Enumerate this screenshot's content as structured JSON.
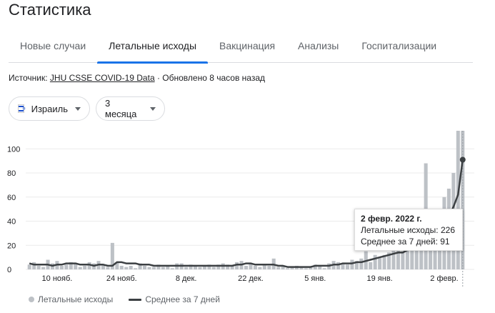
{
  "title": "Статистика",
  "tabs": [
    {
      "label": "Новые случаи",
      "active": false
    },
    {
      "label": "Летальные исходы",
      "active": true
    },
    {
      "label": "Вакцинация",
      "active": false
    },
    {
      "label": "Анализы",
      "active": false
    },
    {
      "label": "Госпитализации",
      "active": false
    }
  ],
  "source": {
    "prefix": "Источник: ",
    "link": "JHU CSSE COVID-19 Data",
    "suffix": " · Обновлено 8 часов назад"
  },
  "filters": {
    "country": "Израиль",
    "period": "3 месяца"
  },
  "colors": {
    "accent": "#1a73e8",
    "bars": "#bdc1c6",
    "avg_line": "#3c4043"
  },
  "tooltip": {
    "date": "2 февр. 2022 г.",
    "deaths": "Летальные исходы: 226",
    "avg": "Среднее за 7 дней: 91"
  },
  "legend": {
    "bars": "Летальные исходы",
    "line": "Среднее за 7 дней"
  },
  "chart_data": {
    "type": "bar",
    "ylim": [
      0,
      115
    ],
    "yticks": [
      "0",
      "20",
      "40",
      "60",
      "80",
      "100"
    ],
    "ytick_values": [
      0,
      20,
      40,
      60,
      80,
      100
    ],
    "xtick_labels": [
      "10 нояб.",
      "24 нояб.",
      "8 дек.",
      "22 дек.",
      "5 янв.",
      "19 янв.",
      "2 февр."
    ],
    "xtick_indices": [
      6,
      20,
      34,
      48,
      62,
      76,
      90
    ],
    "grid": true,
    "legend_position": "bottom-left",
    "series": [
      {
        "name": "Летальные исходы",
        "kind": "bar",
        "values": [
          4,
          6,
          3,
          2,
          8,
          5,
          7,
          3,
          4,
          6,
          5,
          2,
          3,
          6,
          5,
          7,
          4,
          2,
          22,
          6,
          3,
          2,
          3,
          1,
          5,
          3,
          2,
          2,
          4,
          2,
          3,
          1,
          5,
          5,
          2,
          4,
          3,
          2,
          3,
          4,
          2,
          4,
          5,
          4,
          3,
          6,
          7,
          3,
          5,
          3,
          2,
          4,
          3,
          9,
          2,
          3,
          1,
          2,
          3,
          2,
          1,
          2,
          4,
          3,
          1,
          5,
          7,
          6,
          5,
          4,
          8,
          7,
          9,
          15,
          6,
          12,
          10,
          12,
          14,
          16,
          17,
          15,
          22,
          18,
          20,
          24,
          88,
          28,
          34,
          50,
          60,
          67,
          80,
          115,
          226
        ]
      },
      {
        "name": "Среднее за 7 дней",
        "kind": "line",
        "values": [
          5,
          4,
          4,
          4,
          4,
          3,
          4,
          4,
          5,
          5,
          5,
          4,
          4,
          4,
          3,
          4,
          4,
          3,
          3,
          6,
          6,
          5,
          5,
          5,
          4,
          4,
          4,
          3,
          3,
          3,
          3,
          3,
          3,
          3,
          3,
          3,
          3,
          3,
          3,
          3,
          3,
          3,
          3,
          3,
          3,
          4,
          4,
          5,
          5,
          4,
          4,
          4,
          4,
          4,
          3,
          3,
          2,
          2,
          2,
          2,
          2,
          2,
          3,
          3,
          3,
          3,
          4,
          4,
          5,
          5,
          5,
          6,
          6,
          7,
          8,
          9,
          10,
          11,
          12,
          13,
          14,
          14,
          16,
          17,
          18,
          20,
          26,
          28,
          30,
          32,
          38,
          44,
          52,
          62,
          91
        ]
      }
    ]
  }
}
